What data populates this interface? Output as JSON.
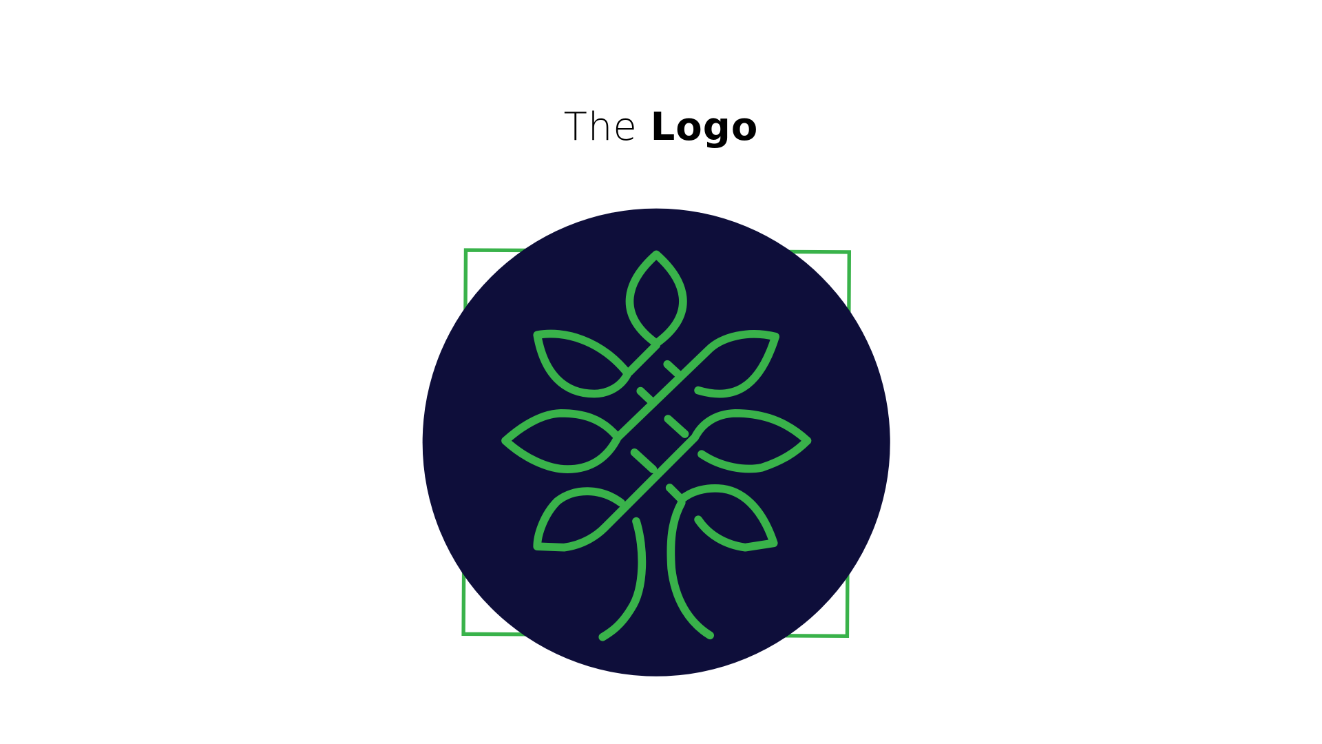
{
  "title": {
    "light": "The",
    "bold": "Logo"
  },
  "logo": {
    "description_icon": "tree-icon",
    "colors": {
      "circle": "#0e0e3a",
      "tree": "#39b24a",
      "frame": "#39b24a",
      "background": "#ffffff"
    }
  }
}
